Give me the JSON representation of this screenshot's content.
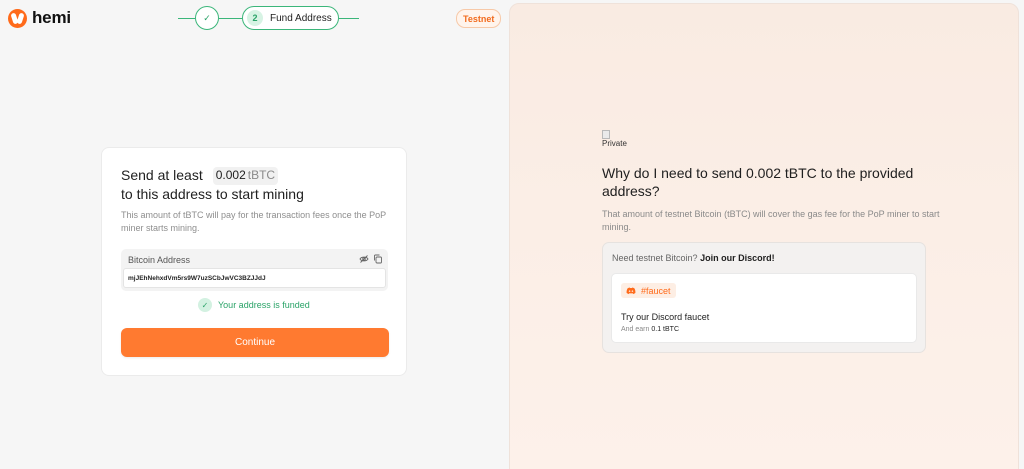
{
  "brand": {
    "name": "hemi",
    "accent_color": "#ff6a1a"
  },
  "stepper": {
    "step1": {
      "status": "completed",
      "icon": "check-icon"
    },
    "step2": {
      "number": "2",
      "label": "Fund Address",
      "status": "current"
    }
  },
  "network_badge": "Testnet",
  "fund_card": {
    "title_prefix": "Send at least",
    "amount": "0.002",
    "unit": "tBTC",
    "title_suffix": "to this address to start mining",
    "description": "This amount of tBTC will pay for the transaction fees once the PoP miner starts mining.",
    "address_label": "Bitcoin Address",
    "address_value": "mjJEhNehxdVm5rs9W7uzSCbJwVC3BZJJdJ",
    "funded_status": "Your address is funded",
    "continue_label": "Continue"
  },
  "info_panel": {
    "image_alt": "Private",
    "title": "Why do I need to send 0.002 tBTC to the provided address?",
    "description": "That amount of testnet Bitcoin (tBTC) will cover the gas fee for the PoP miner to start mining.",
    "discord_prompt": "Need testnet Bitcoin?",
    "discord_link": "Join our Discord!",
    "channel_tag": "#faucet",
    "faucet_title": "Try our Discord faucet",
    "earn_prefix": "And earn",
    "earn_amount": "0.1 tBTC"
  },
  "colors": {
    "success": "#2aa368",
    "button": "#ff7a30",
    "panel_bg": "#fbeee6"
  }
}
